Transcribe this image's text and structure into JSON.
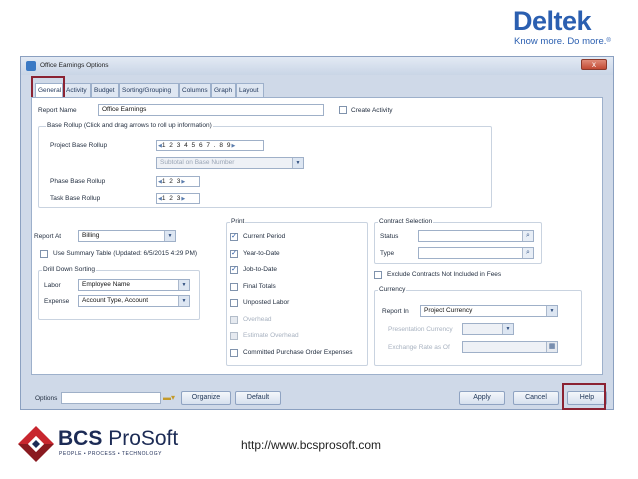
{
  "slide": {
    "deltek_name": "Deltek",
    "deltek_tagline": "Know more. Do more.",
    "deltek_reg": "®",
    "bcs_name_bold": "BCS",
    "bcs_name_light": "ProSoft",
    "bcs_tagline": "PEOPLE • PROCESS • TECHNOLOGY",
    "url": "http://www.bcsprosoft.com"
  },
  "window": {
    "title": "Office Earnings Options",
    "close_label": "x",
    "tabs": [
      {
        "label": "General",
        "active": true
      },
      {
        "label": "Activity",
        "active": false
      },
      {
        "label": "Budget",
        "active": false
      },
      {
        "label": "Sorting/Grouping",
        "active": false
      },
      {
        "label": "Columns",
        "active": false
      },
      {
        "label": "Graph",
        "active": false
      },
      {
        "label": "Layout",
        "active": false
      }
    ]
  },
  "general": {
    "report_name_label": "Report Name",
    "report_name_value": "Office Earnings",
    "create_activity_label": "Create Activity",
    "create_activity_checked": false,
    "base_rollup_group": "Base Rollup (Click and drag arrows to roll up information)",
    "project_base_rollup_label": "Project Base Rollup",
    "project_base_rollup_value": "1 2 3 4 5 6 7 . 8 9",
    "subtotal_placeholder": "Subtotal on Base Number",
    "phase_base_rollup_label": "Phase Base Rollup",
    "phase_base_rollup_value": "1 2 3",
    "task_base_rollup_label": "Task Base Rollup",
    "task_base_rollup_value": "1 2 3",
    "report_at_label": "Report At",
    "report_at_value": "Billing",
    "summary_table_label": "Use Summary Table (Updated: 6/5/2015 4:29 PM)",
    "drill_down_group": "Drill Down Sorting",
    "labor_label": "Labor",
    "labor_value": "Employee Name",
    "expense_label": "Expense",
    "expense_value": "Account Type, Account"
  },
  "print": {
    "group_label": "Print",
    "items": [
      {
        "label": "Current Period",
        "checked": true,
        "disabled": false
      },
      {
        "label": "Year-to-Date",
        "checked": true,
        "disabled": false
      },
      {
        "label": "Job-to-Date",
        "checked": true,
        "disabled": false
      },
      {
        "label": "Final Totals",
        "checked": false,
        "disabled": false
      },
      {
        "label": "Unposted Labor",
        "checked": false,
        "disabled": false
      },
      {
        "label": "Overhead",
        "checked": false,
        "disabled": true
      },
      {
        "label": "Estimate Overhead",
        "checked": false,
        "disabled": true
      },
      {
        "label": "Committed Purchase Order Expenses",
        "checked": false,
        "disabled": false
      }
    ]
  },
  "contract": {
    "group_label": "Contract Selection",
    "status_label": "Status",
    "type_label": "Type",
    "exclude_label": "Exclude Contracts Not Included in Fees",
    "currency_group": "Currency",
    "report_in_label": "Report In",
    "report_in_value": "Project Currency",
    "presentation_label": "Presentation Currency",
    "exchange_label": "Exchange Rate as Of"
  },
  "footer": {
    "options_label": "Options",
    "organize_label": "Organize",
    "default_label": "Default",
    "apply_label": "Apply",
    "cancel_label": "Cancel",
    "help_label": "Help"
  },
  "colors": {
    "highlight": "#8b2232",
    "deltek_blue": "#2b5fb0",
    "bcs_red": "#c8262e",
    "bcs_navy": "#1c2b55"
  }
}
